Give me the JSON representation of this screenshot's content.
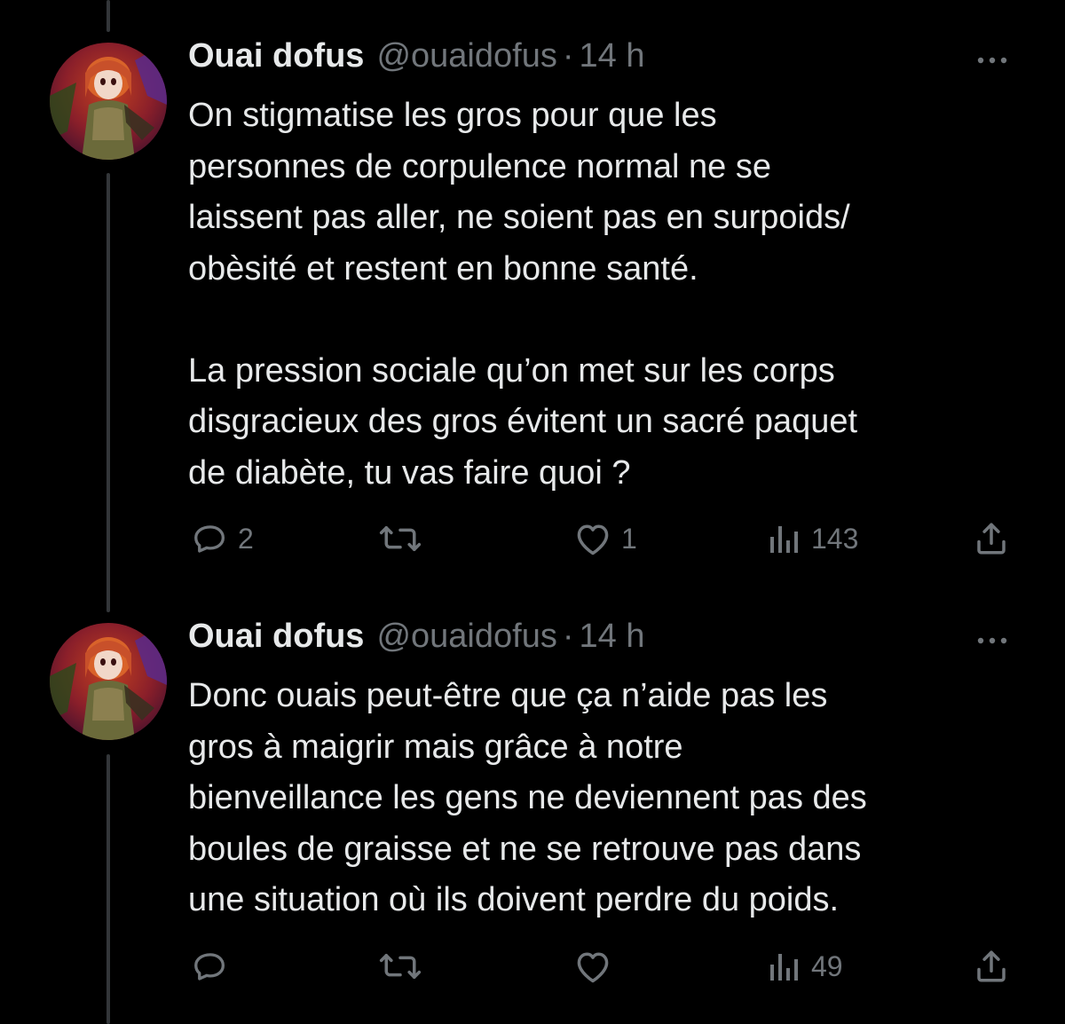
{
  "tweets": [
    {
      "author_name": "Ouai dofus",
      "handle": "@ouaidofus",
      "separator": "·",
      "time": "14 h",
      "avatar_icon": "anime-character-avatar",
      "text_lines": [
        "On stigmatise les gros pour que les",
        "personnes de corpulence normal ne se",
        "laissent pas aller, ne soient pas en surpoids/",
        "obèsité et restent en bonne santé.",
        "",
        "La pression sociale qu’on met sur les corps",
        "disgracieux des gros évitent un sacré paquet",
        "de diabète, tu vas faire quoi ?"
      ],
      "actions": {
        "reply_count": "2",
        "retweet_count": "",
        "like_count": "1",
        "views_count": "143"
      }
    },
    {
      "author_name": "Ouai dofus",
      "handle": "@ouaidofus",
      "separator": "·",
      "time": "14 h",
      "avatar_icon": "anime-character-avatar",
      "text_lines": [
        "Donc ouais peut-être que ça n’aide pas les",
        "gros à maigrir mais grâce à notre",
        "bienveillance les gens ne deviennent pas des",
        "boules de graisse et ne se retrouve pas dans",
        "une situation où ils doivent perdre du poids."
      ],
      "actions": {
        "reply_count": "",
        "retweet_count": "",
        "like_count": "",
        "views_count": "49"
      }
    }
  ],
  "icons": {
    "reply": "reply-icon",
    "retweet": "retweet-icon",
    "like": "heart-icon",
    "views": "views-chart-icon",
    "share": "share-icon",
    "more": "more-options-icon"
  },
  "colors": {
    "background": "#000000",
    "text_primary": "#e7e9ea",
    "text_secondary": "#71767b",
    "thread_line": "#333639"
  }
}
